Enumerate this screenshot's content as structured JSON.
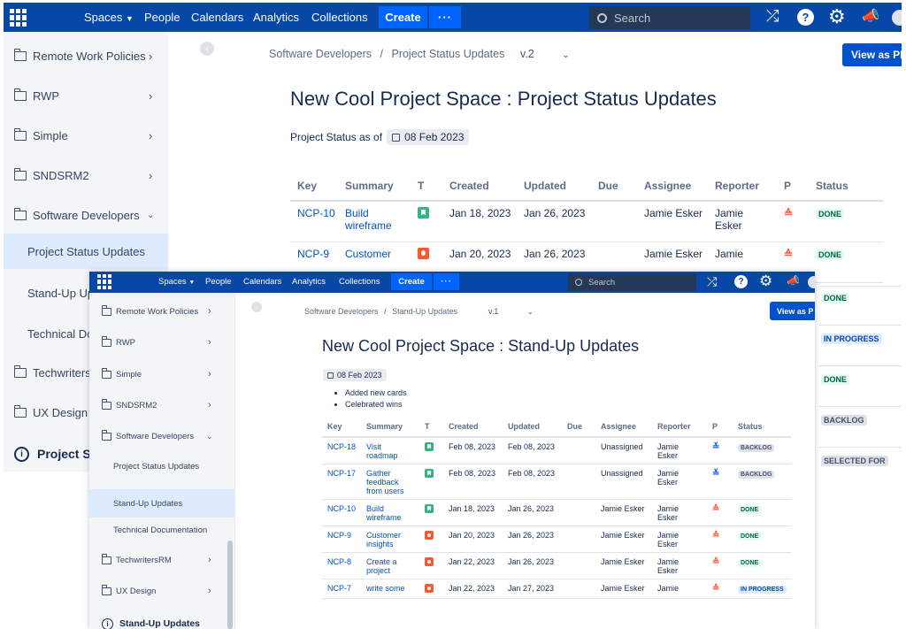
{
  "topbar": {
    "spaces": "Spaces",
    "people": "People",
    "calendars": "Calendars",
    "analytics": "Analytics",
    "collections": "Collections",
    "create": "Create",
    "more": "···",
    "search_placeholder": "Search"
  },
  "back_window": {
    "sidebar": {
      "items": [
        "Remote Work Policies",
        "RWP",
        "Simple",
        "SNDSRM2",
        "Software Developers",
        "Project Status Updates",
        "Stand-Up Up",
        "Technical Do",
        "TechwritersR",
        "UX Design",
        "Project S"
      ]
    },
    "breadcrumb": {
      "space": "Software Developers",
      "sep": "/",
      "page": "Project Status Updates",
      "version": "v.2"
    },
    "view_button": "View as PD",
    "title": "New Cool Project Space : Project Status Updates",
    "status_label": "Project Status as of",
    "date": "08 Feb 2023",
    "columns": [
      "Key",
      "Summary",
      "T",
      "Created",
      "Updated",
      "Due",
      "Assignee",
      "Reporter",
      "P",
      "Status"
    ],
    "rows": [
      {
        "key": "NCP-10",
        "summary1": "Build",
        "summary2": "wireframe",
        "created": "Jan 18, 2023",
        "updated": "Jan 26, 2023",
        "assignee": "Jamie Esker",
        "reporter1": "Jamie",
        "reporter2": "Esker",
        "status": "DONE"
      },
      {
        "key": "NCP-9",
        "summary1": "Customer",
        "summary2": "",
        "created": "Jan 20, 2023",
        "updated": "Jan 26, 2023",
        "assignee": "Jamie Esker",
        "reporter1": "Jamie",
        "reporter2": "",
        "status": "DONE"
      }
    ],
    "extra_statuses": [
      "DONE",
      "IN PROGRESS",
      "DONE",
      "BACKLOG",
      "SELECTED FOR"
    ]
  },
  "front_window": {
    "sidebar": {
      "items": [
        "Remote Work Policies",
        "RWP",
        "Simple",
        "SNDSRM2",
        "Software Developers",
        "Project Status Updates",
        "Stand-Up Updates",
        "Technical Documentation",
        "TechwritersRM",
        "UX Design"
      ],
      "footer": "Stand-Up Updates"
    },
    "breadcrumb": {
      "space": "Software Developers",
      "sep": "/",
      "page": "Stand-Up Updates",
      "version": "v.1"
    },
    "view_button": "View as P",
    "title": "New Cool Project Space : Stand-Up Updates",
    "date": "08 Feb 2023",
    "bullets": [
      "Added new cards",
      "Celebrated wins"
    ],
    "columns": [
      "Key",
      "Summary",
      "T",
      "Created",
      "Updated",
      "Due",
      "Assignee",
      "Reporter",
      "P",
      "Status"
    ],
    "rows": [
      {
        "key": "NCP-18",
        "s": [
          "Visit",
          "roadmap"
        ],
        "type": "story",
        "created": "Feb 08, 2023",
        "updated": "Feb 08, 2023",
        "assignee": "Unassigned",
        "r": [
          "Jamie",
          "Esker"
        ],
        "prio": "low",
        "status": "BACKLOG"
      },
      {
        "key": "NCP-17",
        "s": [
          "Gather",
          "feedback",
          "from users"
        ],
        "type": "story",
        "created": "Feb 08, 2023",
        "updated": "Feb 08, 2023",
        "assignee": "Unassigned",
        "r": [
          "Jamie",
          "Esker"
        ],
        "prio": "low",
        "status": "BACKLOG"
      },
      {
        "key": "NCP-10",
        "s": [
          "Build",
          "wireframe"
        ],
        "type": "story",
        "created": "Jan 18, 2023",
        "updated": "Jan 26, 2023",
        "assignee": "Jamie Esker",
        "r": [
          "Jamie",
          "Esker"
        ],
        "prio": "high",
        "status": "DONE"
      },
      {
        "key": "NCP-9",
        "s": [
          "Customer",
          "insights"
        ],
        "type": "bug",
        "created": "Jan 20, 2023",
        "updated": "Jan 26, 2023",
        "assignee": "Jamie Esker",
        "r": [
          "Jamie",
          "Esker"
        ],
        "prio": "high",
        "status": "DONE"
      },
      {
        "key": "NCP-8",
        "s": [
          "Create a",
          "project"
        ],
        "type": "bug",
        "created": "Jan 22, 2023",
        "updated": "Jan 26, 2023",
        "assignee": "Jamie Esker",
        "r": [
          "Jamie",
          "Esker"
        ],
        "prio": "high",
        "status": "DONE"
      },
      {
        "key": "NCP-7",
        "s": [
          "write some"
        ],
        "type": "bug",
        "created": "Jan 22, 2023",
        "updated": "Jan 27, 2023",
        "assignee": "Jamie Esker",
        "r": [
          "Jamie"
        ],
        "prio": "high",
        "status": "IN PROGRESS"
      }
    ]
  },
  "colors": {
    "topbar": "#0747a6",
    "create": "#0065ff",
    "link": "#0052cc",
    "sidebar_bg": "#f4f5f7",
    "active_bg": "#deebff"
  }
}
